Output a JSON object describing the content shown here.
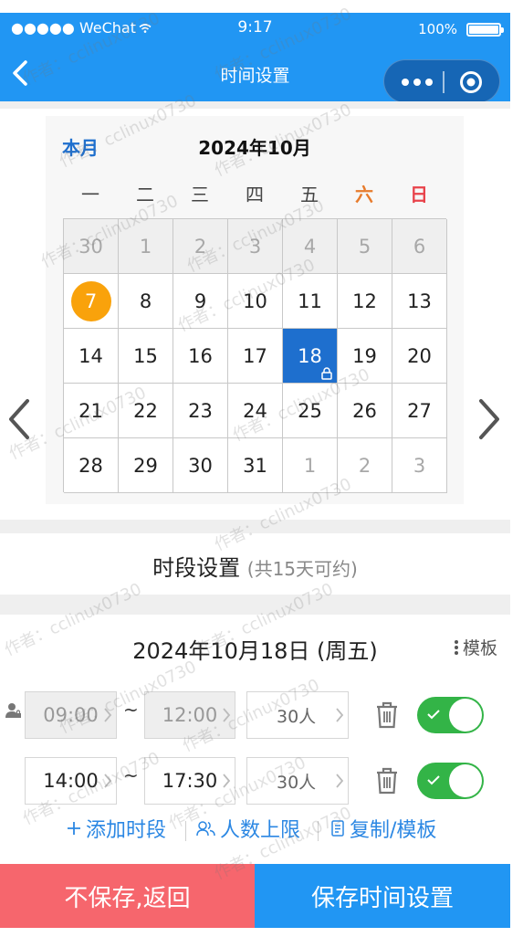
{
  "status_bar": {
    "carrier": "●●●●● WeChat",
    "time": "9:17",
    "battery": "100%"
  },
  "nav": {
    "title": "时间设置",
    "back_icon": "chevron-left-icon",
    "more_icon": "more-dots-icon",
    "close_icon": "target-circle-icon"
  },
  "calendar": {
    "this_month_label": "本月",
    "month_title": "2024年10月",
    "weekdays": [
      "一",
      "二",
      "三",
      "四",
      "五",
      "六",
      "日"
    ],
    "weeks": [
      [
        {
          "day": "30",
          "state": "greyed"
        },
        {
          "day": "1",
          "state": "greyed"
        },
        {
          "day": "2",
          "state": "greyed"
        },
        {
          "day": "3",
          "state": "greyed"
        },
        {
          "day": "4",
          "state": "greyed"
        },
        {
          "day": "5",
          "state": "greyed"
        },
        {
          "day": "6",
          "state": "greyed"
        }
      ],
      [
        {
          "day": "7",
          "state": "today"
        },
        {
          "day": "8",
          "state": "normal"
        },
        {
          "day": "9",
          "state": "normal"
        },
        {
          "day": "10",
          "state": "normal"
        },
        {
          "day": "11",
          "state": "normal"
        },
        {
          "day": "12",
          "state": "normal"
        },
        {
          "day": "13",
          "state": "normal"
        }
      ],
      [
        {
          "day": "14",
          "state": "normal"
        },
        {
          "day": "15",
          "state": "normal"
        },
        {
          "day": "16",
          "state": "normal"
        },
        {
          "day": "17",
          "state": "normal"
        },
        {
          "day": "18",
          "state": "selected",
          "locked": true
        },
        {
          "day": "19",
          "state": "normal"
        },
        {
          "day": "20",
          "state": "normal"
        }
      ],
      [
        {
          "day": "21",
          "state": "normal"
        },
        {
          "day": "22",
          "state": "normal"
        },
        {
          "day": "23",
          "state": "normal"
        },
        {
          "day": "24",
          "state": "normal"
        },
        {
          "day": "25",
          "state": "normal"
        },
        {
          "day": "26",
          "state": "normal"
        },
        {
          "day": "27",
          "state": "normal"
        }
      ],
      [
        {
          "day": "28",
          "state": "normal"
        },
        {
          "day": "29",
          "state": "normal"
        },
        {
          "day": "30",
          "state": "normal"
        },
        {
          "day": "31",
          "state": "normal"
        },
        {
          "day": "1",
          "state": "muted"
        },
        {
          "day": "2",
          "state": "muted"
        },
        {
          "day": "3",
          "state": "muted"
        }
      ]
    ],
    "prev_icon": "chevron-left-icon",
    "next_icon": "chevron-right-icon"
  },
  "period": {
    "title": "时段设置",
    "subtitle": "(共15天可约)"
  },
  "day": {
    "title": "2024年10月18日 (周五)",
    "template_label": "模板",
    "slots": [
      {
        "start": "09:00",
        "end": "12:00",
        "capacity": "30人",
        "enabled": true,
        "disabled_times": true
      },
      {
        "start": "14:00",
        "end": "17:30",
        "capacity": "30人",
        "enabled": true,
        "disabled_times": false
      }
    ],
    "separator": "~",
    "actions": {
      "add": "添加时段",
      "limit": "人数上限",
      "copy": "复制/模板"
    }
  },
  "buttons": {
    "cancel": "不保存,返回",
    "save": "保存时间设置"
  },
  "watermark": "作者：cclinux0730",
  "colors": {
    "primary": "#2196f3",
    "selected": "#1e6fce",
    "today": "#f9a20b",
    "cancel": "#f6666d",
    "toggle_on": "#33b447",
    "saturday": "#e77b2c",
    "sunday": "#e8434b"
  }
}
